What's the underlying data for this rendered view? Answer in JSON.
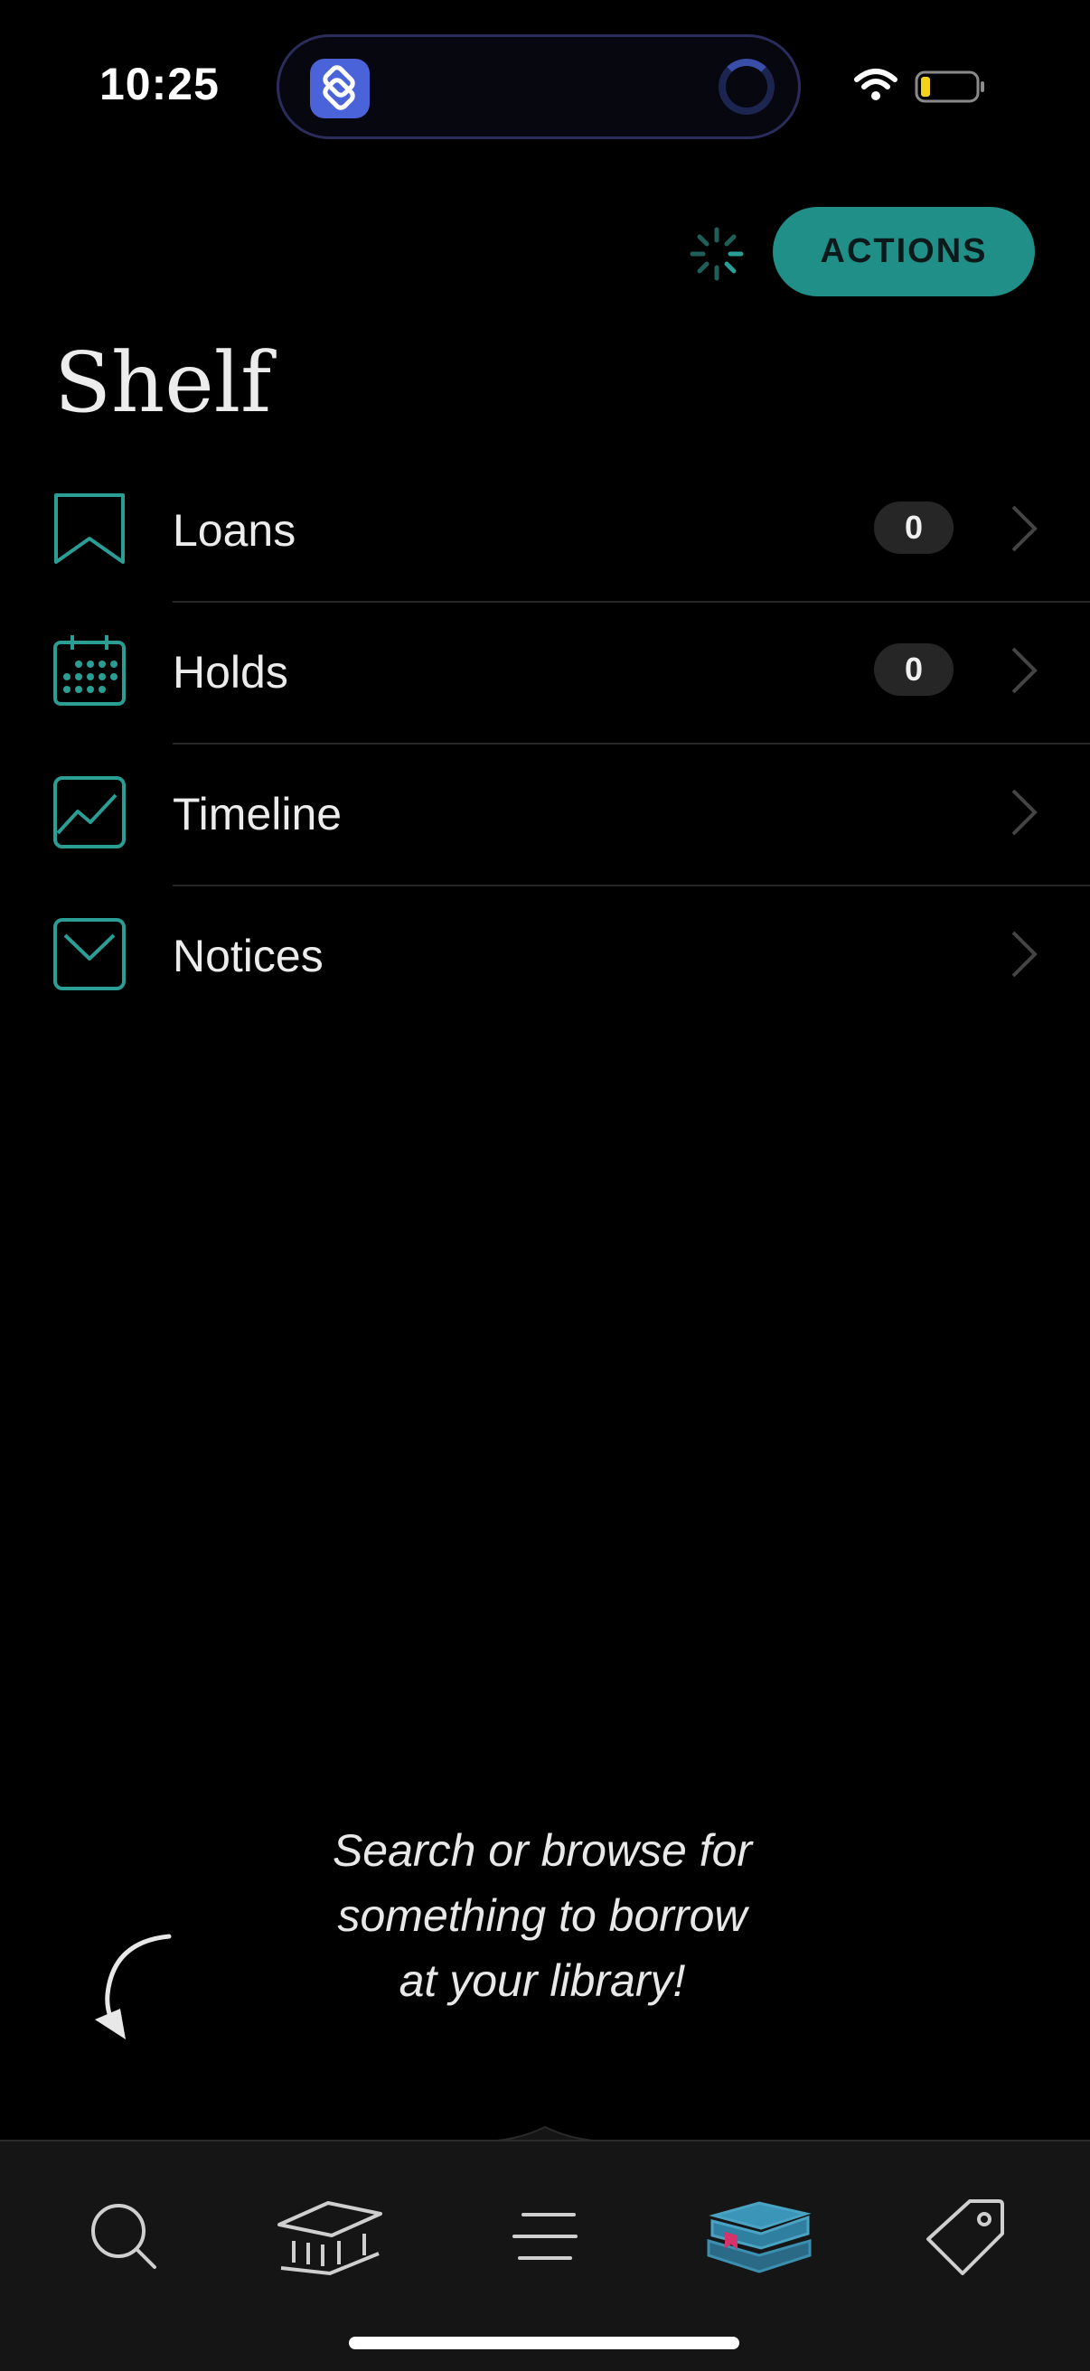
{
  "status_bar": {
    "time": "10:25",
    "battery_level": 0.2
  },
  "header": {
    "actions_label": "ACTIONS",
    "title": "Shelf"
  },
  "shelf_items": [
    {
      "label": "Loans",
      "badge": "0",
      "icon": "bookmark-icon"
    },
    {
      "label": "Holds",
      "badge": "0",
      "icon": "calendar-icon"
    },
    {
      "label": "Timeline",
      "icon": "chart-icon"
    },
    {
      "label": "Notices",
      "icon": "mail-icon"
    }
  ],
  "empty_hint": {
    "line1": "Search or browse for",
    "line2": "something to borrow",
    "line3": "at your library!"
  },
  "tabs": [
    {
      "icon": "search-icon",
      "active": false
    },
    {
      "icon": "library-building-icon",
      "active": false
    },
    {
      "icon": "menu-icon",
      "active": false
    },
    {
      "icon": "books-stack-icon",
      "active": true
    },
    {
      "icon": "tag-icon",
      "active": false
    }
  ],
  "colors": {
    "accent": "#1f8f88",
    "teal_icon": "#2a9d95",
    "active_tab": "#2f7fa0",
    "bookmark_pink": "#d6336c"
  }
}
